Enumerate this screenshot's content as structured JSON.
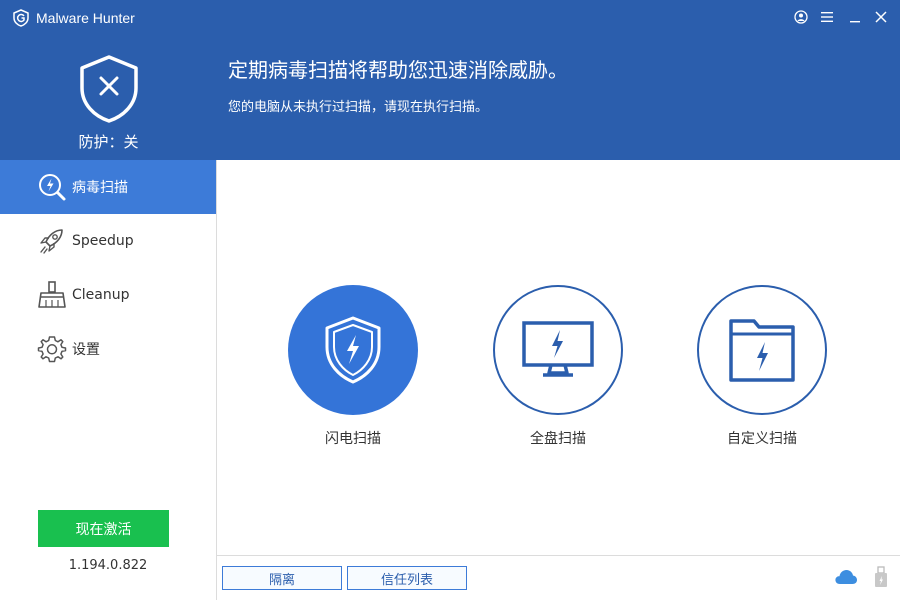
{
  "app": {
    "title": "Malware Hunter"
  },
  "header": {
    "protection_status": "防护：关",
    "headline": "定期病毒扫描将帮助您迅速消除威胁。",
    "subline": "您的电脑从未执行过扫描，请现在执行扫描。"
  },
  "sidebar": {
    "items": [
      {
        "label": "病毒扫描",
        "icon": "scan-icon",
        "active": true
      },
      {
        "label": "Speedup",
        "icon": "rocket-icon",
        "active": false
      },
      {
        "label": "Cleanup",
        "icon": "broom-icon",
        "active": false
      },
      {
        "label": "设置",
        "icon": "gear-icon",
        "active": false
      }
    ],
    "activate_label": "现在激活",
    "version": "1.194.0.822"
  },
  "scan_options": [
    {
      "label": "闪电扫描",
      "icon": "shield-bolt-icon"
    },
    {
      "label": "全盘扫描",
      "icon": "monitor-bolt-icon"
    },
    {
      "label": "自定义扫描",
      "icon": "folder-bolt-icon"
    }
  ],
  "footer": {
    "quarantine_label": "隔离",
    "trust_list_label": "信任列表"
  },
  "colors": {
    "header_bg": "#2b5ead",
    "active_nav": "#3d7bd8",
    "accent_blue": "#3474d8",
    "activate_green": "#19c04f"
  }
}
